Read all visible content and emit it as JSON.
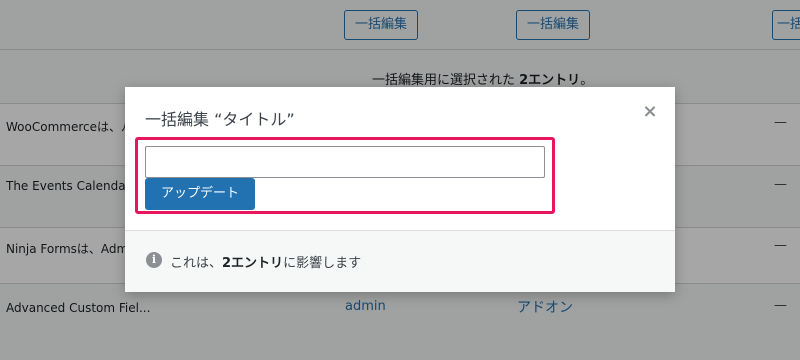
{
  "table": {
    "bulk_edit_buttons": [
      "一括編集",
      "一括編集",
      "一括編集"
    ],
    "selection_notice": {
      "prefix": "一括編集用に選択された ",
      "count": "2エントリ",
      "suffix": "。"
    },
    "rows": [
      {
        "name": "WooCommerceは、ﾉ",
        "dash": "—"
      },
      {
        "name": "The Events Calendar",
        "dash": "—"
      },
      {
        "name": "Ninja Formsは、Adm",
        "dash": "—"
      },
      {
        "name": "Advanced Custom Fiel...",
        "author": "admin",
        "category": "アドオン",
        "dash": "—"
      }
    ]
  },
  "modal": {
    "title": "一括編集 “タイトル”",
    "close_glyph": "×",
    "input_value": "",
    "update_button": "アップデート",
    "info_icon_glyph": "i",
    "footer": {
      "prefix": "これは、",
      "count": "2エントリ",
      "suffix": "に影響します"
    }
  },
  "colors": {
    "accent": "#2271b1",
    "highlight": "#e8175d",
    "overlay": "rgba(0,0,0,0.35)"
  },
  "icons": {
    "close": "close-icon",
    "info": "info-icon"
  }
}
